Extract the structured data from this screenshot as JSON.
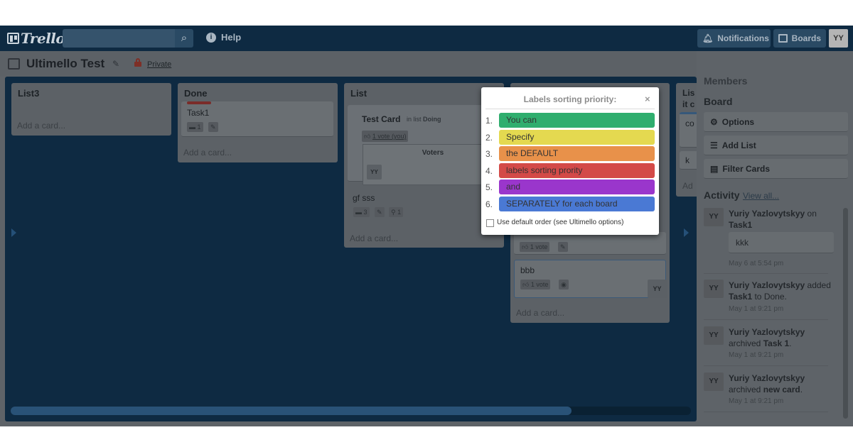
{
  "header": {
    "logo_text": "Trello",
    "search_placeholder": "",
    "help_label": "Help",
    "notifications_label": "Notifications",
    "boards_label": "Boards",
    "user_initials": "YY"
  },
  "board": {
    "title": "Ultimello Test",
    "privacy": "Private"
  },
  "lists": {
    "list3": {
      "title": "List3",
      "add_card": "Add a card..."
    },
    "done": {
      "title": "Done",
      "card_task1": "Task1",
      "card_task1_comments": "1",
      "add_card": "Add a card..."
    },
    "list": {
      "title": "List",
      "test_card_title": "Test Card",
      "test_card_in_list": "in list",
      "test_card_list_name": "Doing",
      "vote_text": "1 vote (you)",
      "voters_title": "Voters",
      "voter_initials": "YY",
      "card_gf_sss": "gf sss",
      "card_gf_sss_comments": "3",
      "card_gf_sss_attachments": "1",
      "add_card": "Add a card..."
    },
    "doing": {
      "card_vote_badge": "1 vote",
      "card_bbb": "bbb",
      "card_bbb_vote_badge": "1 vote",
      "card_bbb_member": "YY",
      "add_card": "Add a card..."
    },
    "partial": {
      "title_line1": "Lis",
      "title_line2": "it c",
      "card1": "co",
      "card2": "k",
      "add_card": "Ad"
    }
  },
  "popover": {
    "title": "Labels sorting priority:",
    "close": "×",
    "labels": [
      {
        "num": "1.",
        "text": "You can",
        "color": "#2fae6e"
      },
      {
        "num": "2.",
        "text": "Specify",
        "color": "#e4d950"
      },
      {
        "num": "3.",
        "text": "the DEFAULT",
        "color": "#e8914a"
      },
      {
        "num": "4.",
        "text": "labels sorting prority",
        "color": "#d34a48"
      },
      {
        "num": "5.",
        "text": "and",
        "color": "#9a36cc"
      },
      {
        "num": "6.",
        "text": "SEPARATELY for each board",
        "color": "#4a79d4"
      }
    ],
    "default_order_label": "Use default order (see Ultimello options)",
    "default_order_checked": false
  },
  "sidebar": {
    "members_heading": "Members",
    "board_heading": "Board",
    "options_label": "Options",
    "add_list_label": "Add List",
    "filter_cards_label": "Filter Cards",
    "activity_heading": "Activity",
    "view_all_label": "View all...",
    "activity": [
      {
        "initials": "YY",
        "user": "Yuriy Yazlovytskyy",
        "action": " on",
        "target": "Task1",
        "suffix": "",
        "comment": "kkk",
        "time": "May 6 at 5:54 pm"
      },
      {
        "initials": "YY",
        "user": "Yuriy Yazlovytskyy",
        "action": " added",
        "target": "Task1",
        "suffix": " to Done.",
        "time": "May 1 at 9:21 pm"
      },
      {
        "initials": "YY",
        "user": "Yuriy Yazlovytskyy",
        "action": " archived",
        "target": "Task 1",
        "suffix": ".",
        "time": "May 1 at 9:21 pm"
      },
      {
        "initials": "YY",
        "user": "Yuriy Yazlovytskyy",
        "action": " archived",
        "target": "new card",
        "suffix": ".",
        "time": "May 1 at 9:21 pm"
      }
    ]
  },
  "colors": {
    "header_bg": "#0e2a42",
    "overlay_grey": "#5e6368",
    "scroll_thumb": "#295277"
  }
}
